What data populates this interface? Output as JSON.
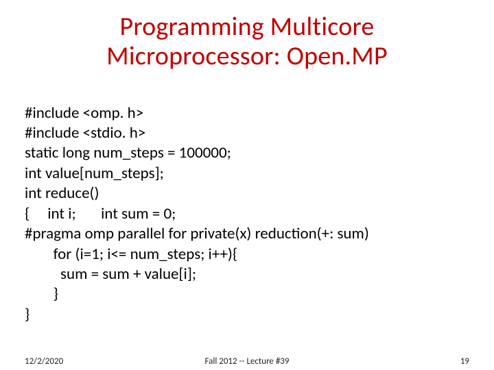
{
  "title_line1": "Programming Multicore",
  "title_line2": "Microprocessor: Open.MP",
  "code": {
    "l1": "#include <omp. h>",
    "l2": "#include <stdio. h>",
    "l3": "static long num_steps = 100000;",
    "l4": "int value[num_steps];",
    "l5": "int reduce()",
    "l6": "{     int i;       int sum = 0;",
    "l7": "#pragma omp parallel for private(x) reduction(+: sum)",
    "l8": "        for (i=1; i<= num_steps; i++){",
    "l9": "          sum = sum + value[i];",
    "l10": "        }",
    "l11": "}"
  },
  "footer": {
    "date": "12/2/2020",
    "center": "Fall 2012 -- Lecture #39",
    "page": "19"
  }
}
